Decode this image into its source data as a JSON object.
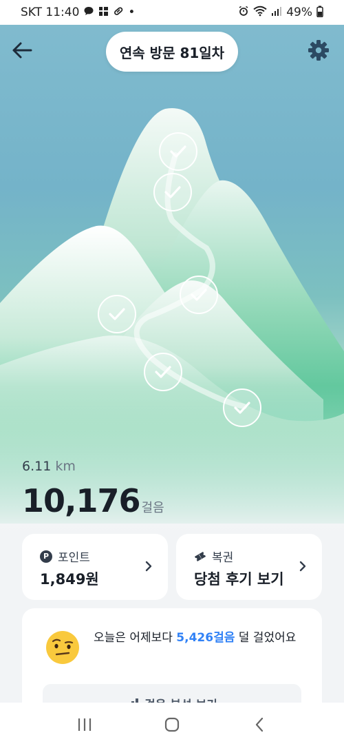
{
  "status_bar": {
    "carrier_time": "SKT 11:40",
    "dot": "•",
    "battery": "49%",
    "icons": [
      "chat-bubble-icon",
      "grid-icon",
      "pill-icon",
      "alarm-icon",
      "wifi-icon",
      "signal-icon",
      "battery-icon"
    ]
  },
  "header": {
    "visit_prefix": "연속 방문 ",
    "visit_days": "81일차",
    "back_icon": "arrow-left-icon",
    "settings_icon": "gear-icon"
  },
  "scene": {
    "checkpoints_completed": 6,
    "colors": {
      "sky": "#7cb9cd",
      "mountain": "#3fbf8f"
    }
  },
  "stats": {
    "distance_value": "6.11",
    "distance_unit": "km",
    "steps_value": "10,176",
    "steps_unit": "걸음"
  },
  "cards": {
    "point": {
      "title": "포인트",
      "badge": "P",
      "value": "1,849원"
    },
    "lotto": {
      "title": "복권",
      "value": "당첨 후기 보기"
    }
  },
  "compare": {
    "text_before": "오늘은 어제보다 ",
    "highlight": "5,426걸음",
    "text_after": " 덜 걸었어요",
    "button_label": "걸음 분석 보기",
    "accent_color": "#3182f6"
  },
  "nav": {
    "recent_icon": "recent-apps-icon",
    "home_icon": "home-icon",
    "back_icon": "nav-back-icon"
  }
}
